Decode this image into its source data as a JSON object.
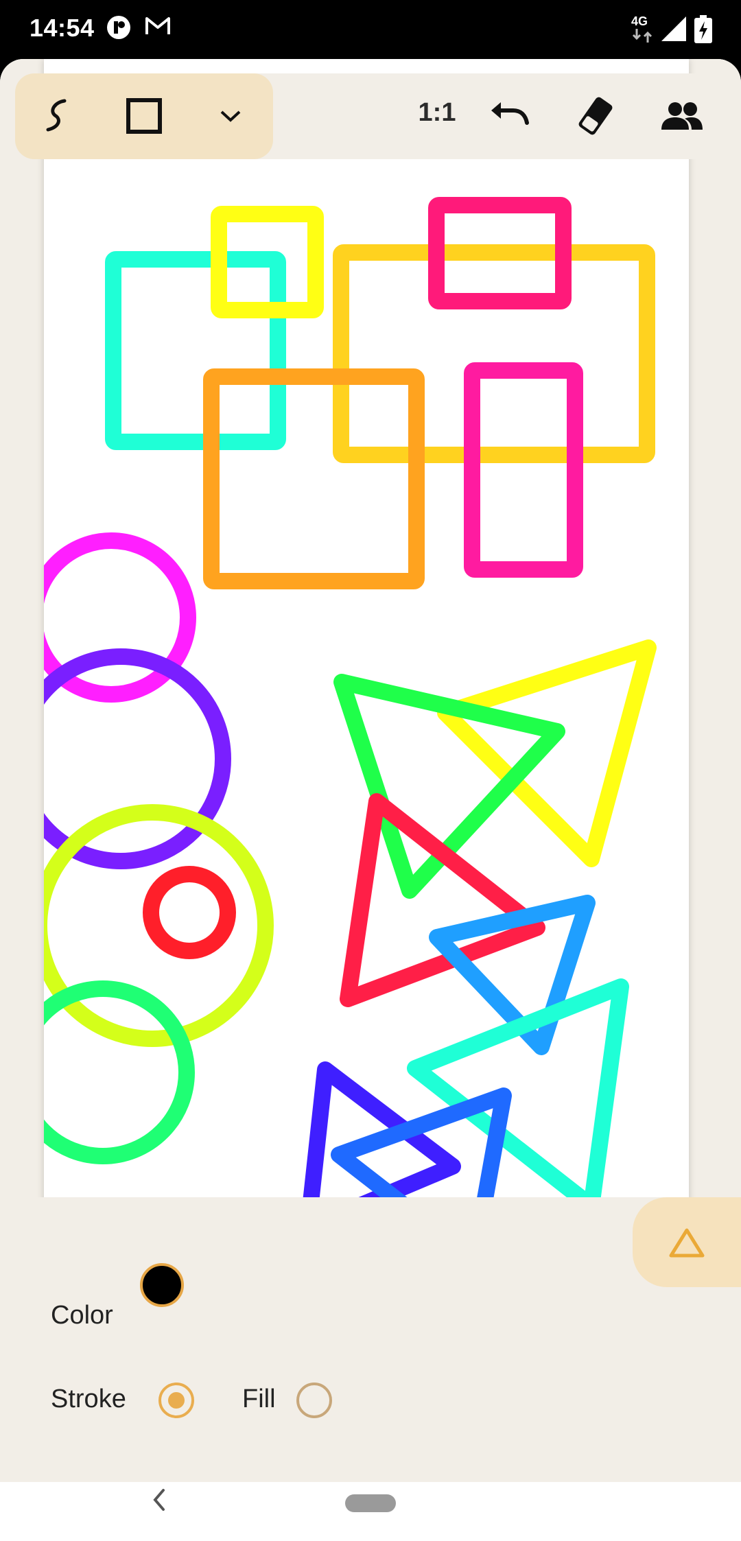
{
  "status_bar": {
    "time": "14:54",
    "network": "4G",
    "icons": [
      "app-notification-icon",
      "gmail-icon",
      "cellular-signal-icon",
      "battery-charging-icon"
    ]
  },
  "toolbar": {
    "tools": [
      "freehand-draw-icon",
      "rectangle-tool-icon",
      "chevron-down-icon"
    ],
    "zoom_label": "1:1",
    "actions": [
      "undo-icon",
      "eraser-icon",
      "people-icon"
    ]
  },
  "bottom_panel": {
    "color_label": "Color",
    "selected_color": "#000000",
    "stroke_label": "Stroke",
    "fill_label": "Fill",
    "stroke_selected": true,
    "fill_selected": false,
    "shape_button_icon": "triangle-icon"
  },
  "colors": {
    "accent": "#e9ad4f",
    "toolbar_highlight": "#f3e3c4",
    "panel_background": "#f2eee7"
  },
  "canvas_shapes": {
    "rectangle_colors": [
      "#1fffd6",
      "#ffff14",
      "#ffd21f",
      "#ff1a7a",
      "#ffa31f",
      "#ff1ba0"
    ],
    "circle_colors": [
      "#ff1fff",
      "#7a1fff",
      "#d4ff1a",
      "#ff1f2a",
      "#1fff74"
    ],
    "triangle_colors": [
      "#ffff14",
      "#1fff4a",
      "#ff1f47",
      "#1f9fff",
      "#1fffd6",
      "#3f1fff",
      "#1f6aff"
    ]
  }
}
